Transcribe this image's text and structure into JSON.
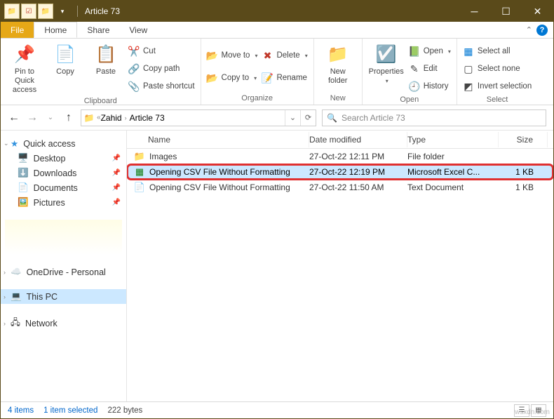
{
  "titlebar": {
    "title": "Article 73"
  },
  "tabs": {
    "file": "File",
    "home": "Home",
    "share": "Share",
    "view": "View"
  },
  "ribbon": {
    "clipboard": {
      "label": "Clipboard",
      "pin": "Pin to Quick access",
      "copy": "Copy",
      "paste": "Paste",
      "cut": "Cut",
      "copypath": "Copy path",
      "pasteshortcut": "Paste shortcut"
    },
    "organize": {
      "label": "Organize",
      "moveto": "Move to",
      "copyto": "Copy to",
      "delete": "Delete",
      "rename": "Rename"
    },
    "new": {
      "label": "New",
      "newfolder": "New folder"
    },
    "open": {
      "label": "Open",
      "properties": "Properties",
      "open": "Open",
      "edit": "Edit",
      "history": "History"
    },
    "select": {
      "label": "Select",
      "all": "Select all",
      "none": "Select none",
      "invert": "Invert selection"
    }
  },
  "address": {
    "parts": [
      "Zahid",
      "Article 73"
    ],
    "searchPlaceholder": "Search Article 73"
  },
  "nav": {
    "quick": "Quick access",
    "desktop": "Desktop",
    "downloads": "Downloads",
    "documents": "Documents",
    "pictures": "Pictures",
    "onedrive": "OneDrive - Personal",
    "thispc": "This PC",
    "network": "Network"
  },
  "columns": {
    "name": "Name",
    "date": "Date modified",
    "type": "Type",
    "size": "Size"
  },
  "files": [
    {
      "name": "Images",
      "date": "27-Oct-22 12:11 PM",
      "type": "File folder",
      "size": "",
      "icon": "folder"
    },
    {
      "name": "Opening CSV File Without Formatting",
      "date": "27-Oct-22 12:19 PM",
      "type": "Microsoft Excel C...",
      "size": "1 KB",
      "icon": "excel",
      "selected": true,
      "highlighted": true
    },
    {
      "name": "Opening CSV File Without Formatting",
      "date": "27-Oct-22 11:50 AM",
      "type": "Text Document",
      "size": "1 KB",
      "icon": "text"
    }
  ],
  "status": {
    "items": "4 items",
    "selected": "1 item selected",
    "bytes": "222 bytes"
  },
  "watermark": "wsxdn.com"
}
